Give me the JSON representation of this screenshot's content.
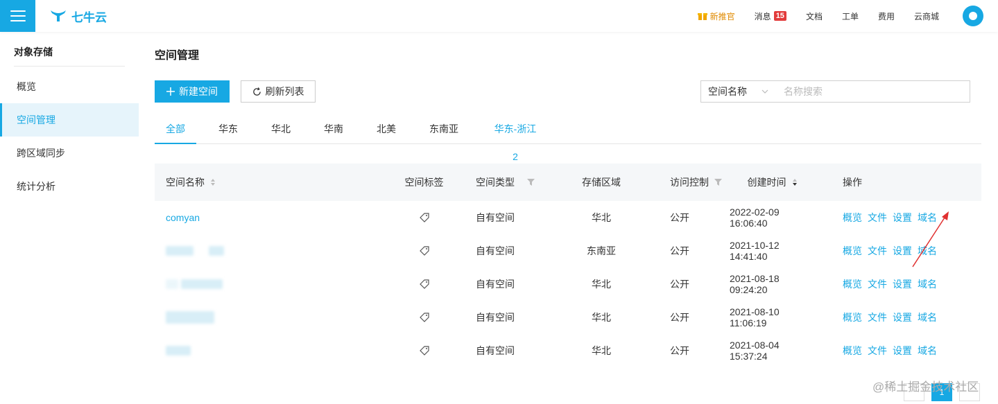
{
  "brand": {
    "name": "七牛云",
    "accent": "#17a8e3"
  },
  "topnav": {
    "promo": "新推官",
    "messages": "消息",
    "message_count": "15",
    "docs": "文档",
    "tickets": "工单",
    "billing": "费用",
    "store": "云商城"
  },
  "sidebar": {
    "title": "对象存储",
    "items": [
      {
        "label": "概览"
      },
      {
        "label": "空间管理"
      },
      {
        "label": "跨区域同步"
      },
      {
        "label": "统计分析"
      }
    ]
  },
  "page": {
    "title": "空间管理",
    "new_button": "新建空间",
    "refresh_button": "刷新列表",
    "search_field": "空间名称",
    "search_placeholder": "名称搜索"
  },
  "tabs": [
    "全部",
    "华东",
    "华北",
    "华南",
    "北美",
    "东南亚",
    "华东-浙江2"
  ],
  "table": {
    "headers": {
      "name": "空间名称",
      "tag": "空间标签",
      "type": "空间类型",
      "region": "存储区域",
      "access": "访问控制",
      "created": "创建时间",
      "actions": "操作"
    },
    "rows": [
      {
        "name": "comyan",
        "type": "自有空间",
        "region": "华北",
        "access": "公开",
        "created": "2022-02-09 16:06:40"
      },
      {
        "name": "",
        "type": "自有空间",
        "region": "东南亚",
        "access": "公开",
        "created": "2021-10-12 14:41:40"
      },
      {
        "name": "",
        "type": "自有空间",
        "region": "华北",
        "access": "公开",
        "created": "2021-08-18 09:24:20"
      },
      {
        "name": "",
        "type": "自有空间",
        "region": "华北",
        "access": "公开",
        "created": "2021-08-10 11:06:19"
      },
      {
        "name": "",
        "type": "自有空间",
        "region": "华北",
        "access": "公开",
        "created": "2021-08-04 15:37:24"
      }
    ],
    "actions": [
      "概览",
      "文件",
      "设置",
      "域名"
    ]
  },
  "pager": {
    "current": "1"
  },
  "watermark": "@稀土掘金技术社区"
}
